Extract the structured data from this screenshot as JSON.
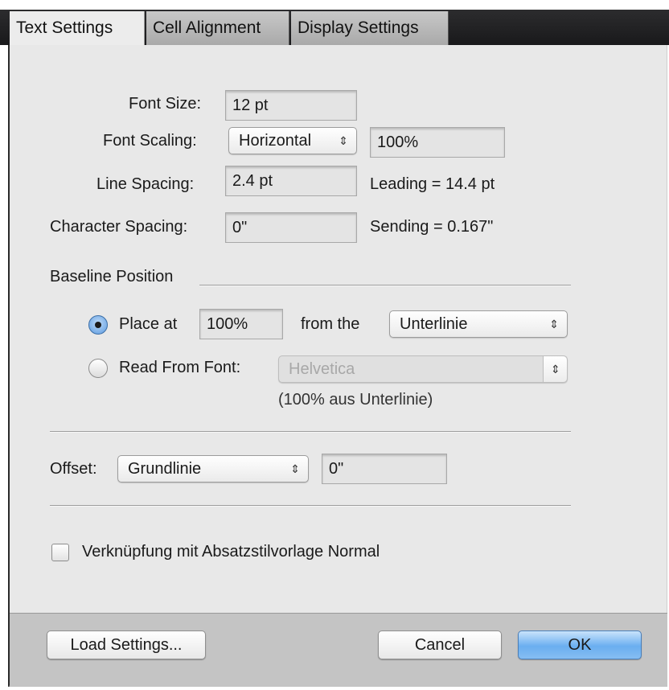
{
  "tabs": [
    {
      "label": "Text Settings"
    },
    {
      "label": "Cell Alignment"
    },
    {
      "label": "Display Settings"
    }
  ],
  "text_settings": {
    "font_size": {
      "label": "Font Size:",
      "value": "12 pt"
    },
    "font_scaling": {
      "label": "Font Scaling:",
      "mode": "Horizontal",
      "value": "100%"
    },
    "line_spacing": {
      "label": "Line Spacing:",
      "value": "2.4 pt",
      "note": "Leading = 14.4 pt"
    },
    "character_spacing": {
      "label": "Character Spacing:",
      "value": "0\"",
      "note": "Sending = 0.167\""
    }
  },
  "baseline": {
    "heading": "Baseline Position",
    "place_at": {
      "label": "Place at",
      "value": "100%",
      "selected": true
    },
    "from_the": {
      "label": "from the",
      "value": "Unterlinie"
    },
    "read_from_font": {
      "label": "Read From Font:",
      "value": "Helvetica",
      "selected": false
    },
    "font_note": "(100% aus Unterlinie)"
  },
  "offset": {
    "label": "Offset:",
    "mode": "Grundlinie",
    "value": "0\""
  },
  "link_checkbox": {
    "label": "Verknüpfung mit Absatzstilvorlage Normal",
    "checked": false
  },
  "footer": {
    "load_settings": "Load Settings...",
    "cancel": "Cancel",
    "ok": "OK"
  },
  "icons": {
    "popup_arrows": "updown-chevron-icon"
  },
  "colors": {
    "accent": "#6aaef0",
    "tab_bar": "#1f1f21"
  }
}
